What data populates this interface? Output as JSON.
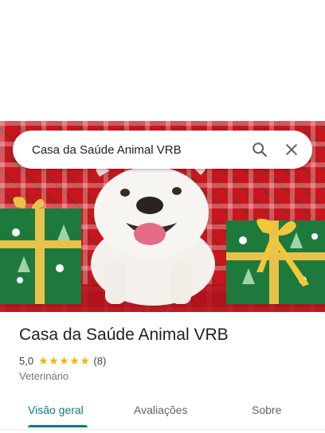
{
  "search": {
    "query": "Casa da Saúde Animal VRB"
  },
  "icons": {
    "search": "search-icon",
    "close": "close-icon",
    "star": "star-icon"
  },
  "place": {
    "name": "Casa da Saúde Animal VRB",
    "rating": "5,0",
    "stars_filled": 5,
    "review_count": "(8)",
    "category": "Veterinário"
  },
  "tabs": [
    {
      "label": "Visão geral",
      "active": true
    },
    {
      "label": "Avaliações",
      "active": false
    },
    {
      "label": "Sobre",
      "active": false
    }
  ],
  "colors": {
    "accent": "#0b7a8a",
    "star": "#f4b400",
    "text": "#202124",
    "muted": "#70757a"
  }
}
